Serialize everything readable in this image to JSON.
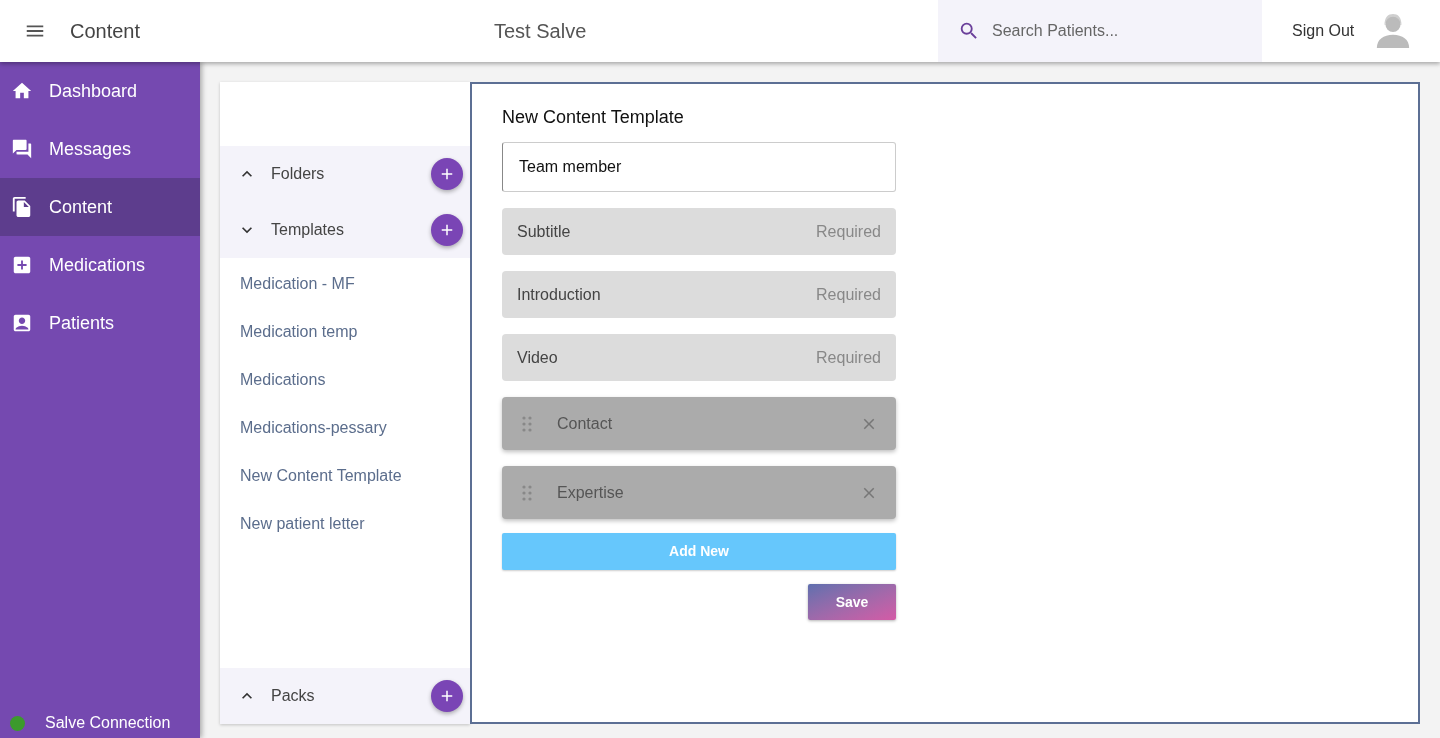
{
  "header": {
    "title": "Content",
    "app_name": "Test Salve",
    "search": {
      "placeholder": "Search Patients..."
    },
    "sign_out": "Sign Out"
  },
  "nav": [
    {
      "label": "Dashboard",
      "selected": false
    },
    {
      "label": "Messages",
      "selected": false
    },
    {
      "label": "Content",
      "selected": true
    },
    {
      "label": "Medications",
      "selected": false
    },
    {
      "label": "Patients",
      "selected": false
    }
  ],
  "connection": {
    "label": "Salve Connection",
    "connected": true
  },
  "sections": [
    {
      "title": "Folders",
      "expanded": false
    },
    {
      "title": "Templates",
      "expanded": true,
      "items": [
        "Medication - MF",
        "Medication temp",
        "Medications",
        "Medications-pessary",
        "New Content Template",
        "New patient letter"
      ]
    }
  ],
  "packs": {
    "title": "Packs",
    "expanded": false
  },
  "editor": {
    "title": "New Content Template",
    "name_value": "Team member",
    "fields": [
      {
        "kind": "fixed",
        "label": "Subtitle",
        "note": "Required"
      },
      {
        "kind": "fixed",
        "label": "Introduction",
        "note": "Required"
      },
      {
        "kind": "fixed",
        "label": "Video",
        "note": "Required"
      },
      {
        "kind": "custom",
        "label": "Contact"
      },
      {
        "kind": "custom",
        "label": "Expertise"
      }
    ],
    "add_button": "Add New",
    "save_button": "Save"
  }
}
